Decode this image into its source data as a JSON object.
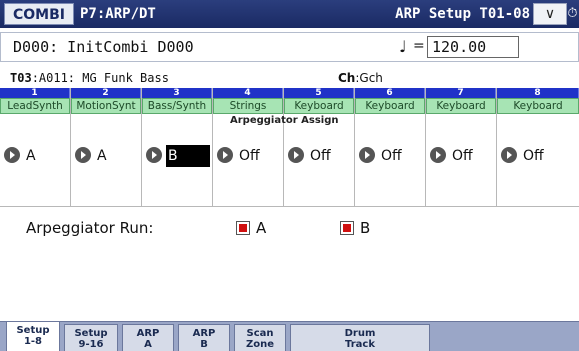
{
  "header": {
    "mode": "COMBI",
    "page": "P7:ARP/DT",
    "title": "ARP Setup T01-08",
    "menu_symbol": "∨",
    "timer_symbol": "⏱"
  },
  "program": {
    "name": "D000: InitCombi D000",
    "tempo_symbol": "♩",
    "tempo_eq": "=",
    "tempo": "120.00"
  },
  "track": {
    "id": "T03",
    "info": ":A011: MG Funk Bass",
    "channel_label": "Ch",
    "channel_value": ":Gch"
  },
  "assign_caption": "Arpeggiator Assign",
  "tracks": [
    {
      "num": "1",
      "name": "LeadSynth",
      "assign": "A"
    },
    {
      "num": "2",
      "name": "MotionSynt",
      "assign": "A"
    },
    {
      "num": "3",
      "name": "Bass/Synth",
      "assign": "B"
    },
    {
      "num": "4",
      "name": "Strings",
      "assign": "Off"
    },
    {
      "num": "5",
      "name": "Keyboard",
      "assign": "Off"
    },
    {
      "num": "6",
      "name": "Keyboard",
      "assign": "Off"
    },
    {
      "num": "7",
      "name": "Keyboard",
      "assign": "Off"
    },
    {
      "num": "8",
      "name": "Keyboard",
      "assign": "Off"
    }
  ],
  "arp_run": {
    "label": "Arpeggiator Run:",
    "a_label": "A",
    "b_label": "B"
  },
  "tabs": [
    {
      "line1": "Setup",
      "line2": "1-8"
    },
    {
      "line1": "Setup",
      "line2": "9-16"
    },
    {
      "line1": "ARP",
      "line2": "A"
    },
    {
      "line1": "ARP",
      "line2": "B"
    },
    {
      "line1": "Scan",
      "line2": "Zone"
    },
    {
      "line1": "Drum",
      "line2": "Track"
    }
  ]
}
